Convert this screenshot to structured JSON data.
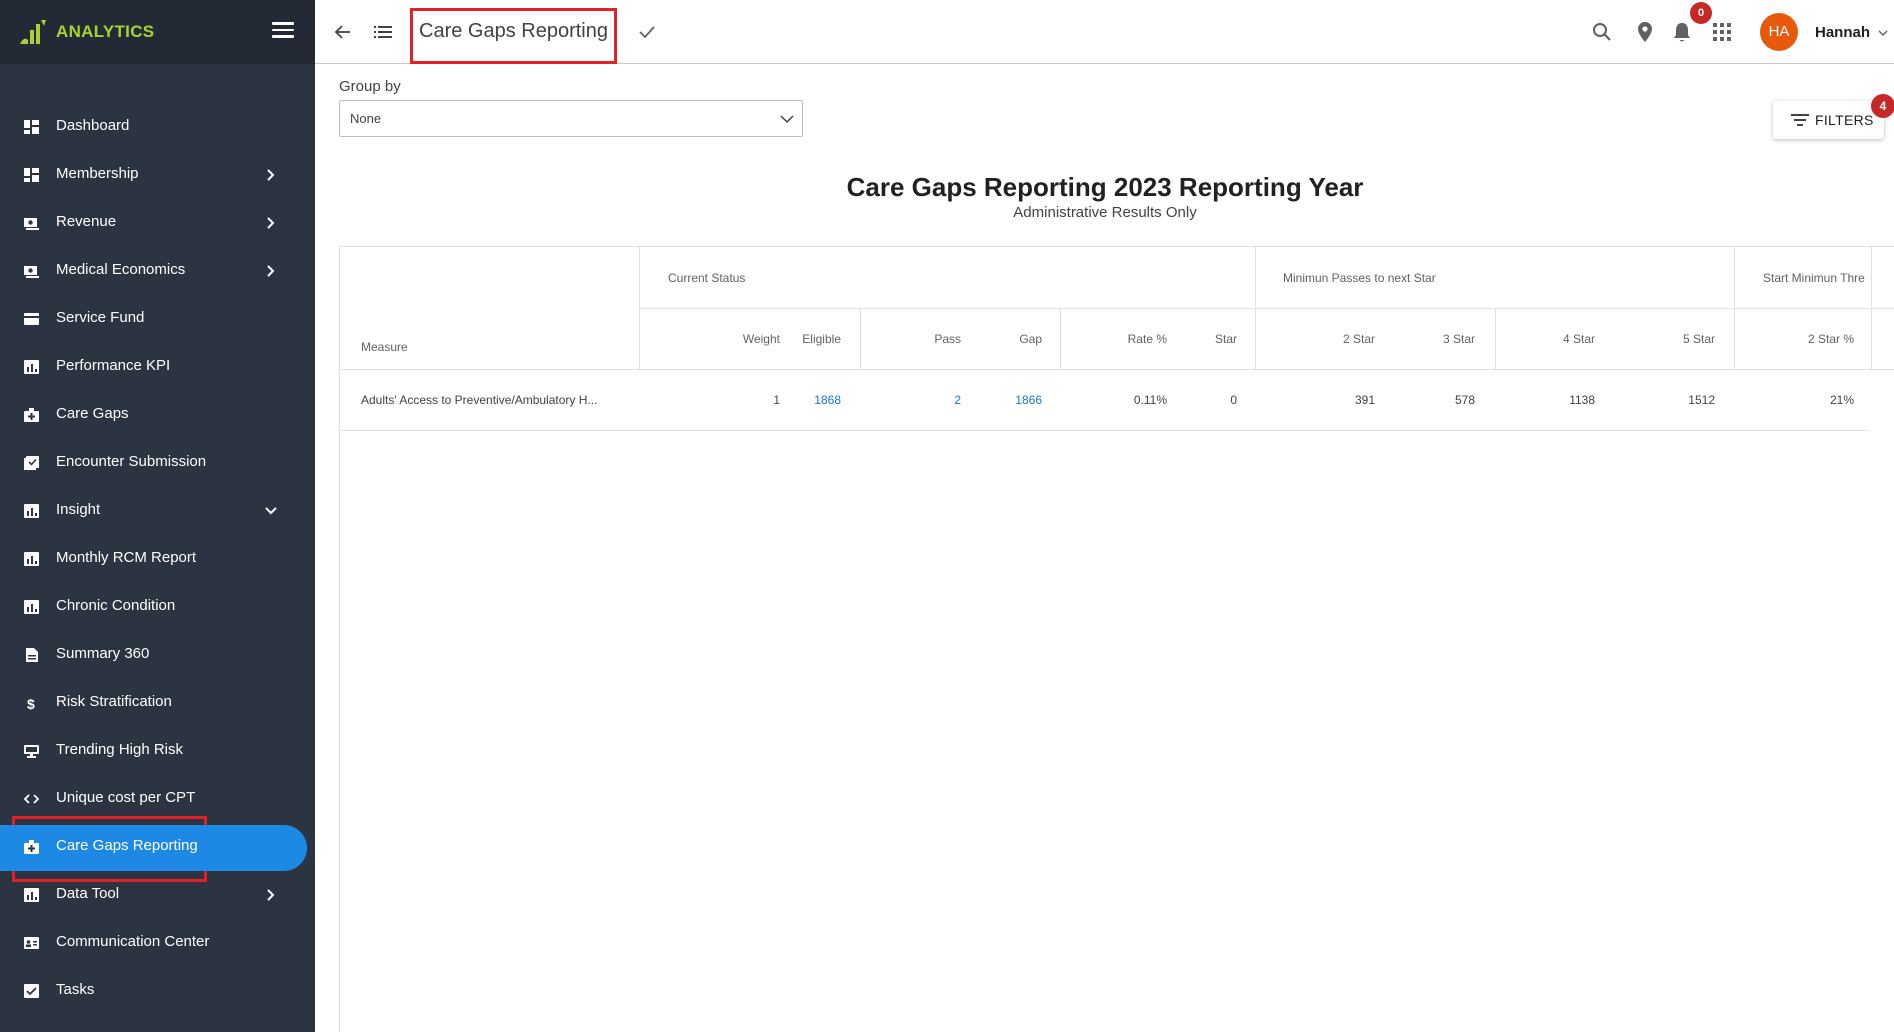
{
  "app": {
    "brand": "ANALYTICS",
    "brand_color": "#a8d233",
    "sidebar_bg": "#2d3441",
    "active_color": "#1e88e5"
  },
  "sidebar": {
    "items": [
      {
        "label": "Dashboard",
        "icon": "dashboard-icon",
        "expandable": false
      },
      {
        "label": "Membership",
        "icon": "dashboard-icon",
        "expandable": true
      },
      {
        "label": "Revenue",
        "icon": "money-icon",
        "expandable": true
      },
      {
        "label": "Medical Economics",
        "icon": "money-icon",
        "expandable": true
      },
      {
        "label": "Service Fund",
        "icon": "card-icon",
        "expandable": false
      },
      {
        "label": "Performance KPI",
        "icon": "bar-chart-icon",
        "expandable": false
      },
      {
        "label": "Care Gaps",
        "icon": "medical-bag-icon",
        "expandable": false
      },
      {
        "label": "Encounter Submission",
        "icon": "checklist-icon",
        "expandable": false
      },
      {
        "label": "Insight",
        "icon": "bar-chart-icon",
        "expandable": true
      },
      {
        "label": "Monthly RCM Report",
        "icon": "bar-chart-icon",
        "expandable": false
      },
      {
        "label": "Chronic Condition",
        "icon": "bar-chart-icon",
        "expandable": false
      },
      {
        "label": "Summary 360",
        "icon": "document-icon",
        "expandable": false
      },
      {
        "label": "Risk Stratification",
        "icon": "dollar-icon",
        "expandable": false
      },
      {
        "label": "Trending High Risk",
        "icon": "monitor-icon",
        "expandable": false
      },
      {
        "label": "Unique cost per CPT",
        "icon": "code-icon",
        "expandable": false
      },
      {
        "label": "Care Gaps Reporting",
        "icon": "medical-bag-icon",
        "expandable": false,
        "active": true
      },
      {
        "label": "Data Tool",
        "icon": "bar-chart-icon",
        "expandable": true
      },
      {
        "label": "Communication Center",
        "icon": "contact-card-icon",
        "expandable": false
      },
      {
        "label": "Tasks",
        "icon": "task-icon",
        "expandable": false
      }
    ]
  },
  "topbar": {
    "title": "Care Gaps Reporting",
    "notification_count": "0",
    "avatar_initials": "HA",
    "avatar_color": "#e8590c",
    "user_name": "Hannah"
  },
  "controls": {
    "group_by_label": "Group by",
    "group_by_value": "None",
    "filters_label": "FILTERS",
    "filters_count": "4"
  },
  "report": {
    "title": "Care Gaps Reporting 2023 Reporting Year",
    "subtitle": "Administrative Results Only"
  },
  "table": {
    "group_headers": {
      "current_status": "Current Status",
      "min_passes": "Minimun Passes to next Star",
      "start_min_threshold": "Start Minimun Thre"
    },
    "columns": {
      "measure": "Measure",
      "weight": "Weight",
      "eligible": "Eligible",
      "pass": "Pass",
      "gap": "Gap",
      "rate": "Rate %",
      "star": "Star",
      "star2": "2 Star",
      "star3": "3 Star",
      "star4": "4 Star",
      "star5": "5 Star",
      "star2pct": "2 Star %"
    },
    "rows": [
      {
        "measure": "Adults' Access to Preventive/Ambulatory H...",
        "weight": "1",
        "eligible": "1868",
        "pass": "2",
        "gap": "1866",
        "rate": "0.11%",
        "star": "0",
        "star2": "391",
        "star3": "578",
        "star4": "1138",
        "star5": "1512",
        "star2pct": "21%"
      }
    ]
  }
}
